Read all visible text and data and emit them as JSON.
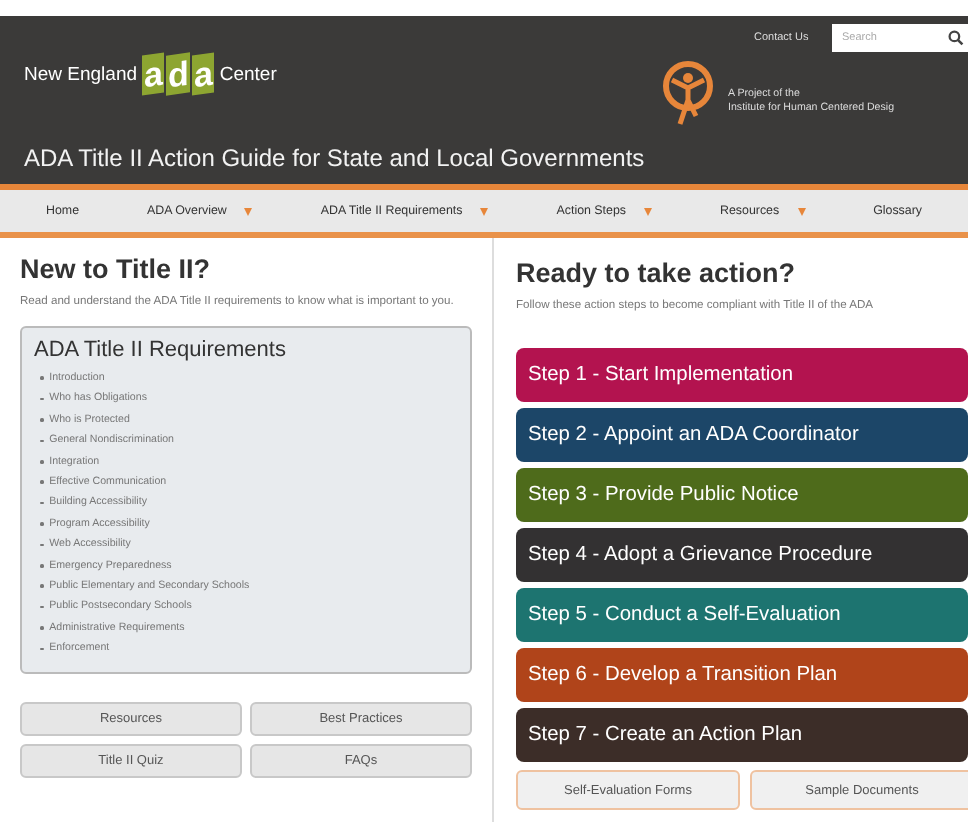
{
  "header": {
    "brand_before": "New England",
    "brand_mark": "ada",
    "brand_after": "Center",
    "contact_link": "Contact Us",
    "search": {
      "placeholder": "Search"
    },
    "project_line_1": "A Project of the",
    "project_line_2": "Institute for Human Centered Desig",
    "title": "ADA Title II Action Guide for State and Local Governments"
  },
  "nav": [
    {
      "label": "Home",
      "has_dropdown": false
    },
    {
      "label": "ADA Overview",
      "has_dropdown": true
    },
    {
      "label": "ADA Title II Requirements",
      "has_dropdown": true
    },
    {
      "label": "Action Steps",
      "has_dropdown": true
    },
    {
      "label": "Resources",
      "has_dropdown": true
    },
    {
      "label": "Glossary",
      "has_dropdown": false
    }
  ],
  "left": {
    "heading": "New to Title II?",
    "intro": "Read and understand the ADA Title II requirements to know what is important to you.",
    "box_title": "ADA Title II Requirements",
    "requirements": [
      "Introduction",
      "Who has Obligations",
      "Who is Protected",
      "General Nondiscrimination",
      "Integration",
      "Effective Communication",
      "Building Accessibility",
      "Program Accessibility",
      "Web Accessibility",
      "Emergency Preparedness",
      "Public Elementary and Secondary Schools",
      "Public Postsecondary Schools",
      "Administrative Requirements",
      "Enforcement"
    ],
    "buttons": [
      "Resources",
      "Best Practices",
      "Title II Quiz",
      "FAQs"
    ]
  },
  "right": {
    "heading": "Ready to take action?",
    "intro": "Follow these action steps to become compliant with Title II of the ADA",
    "steps": [
      {
        "label": "Step 1 - Start Implementation",
        "color": "#b3134f"
      },
      {
        "label": "Step 2 - Appoint an ADA Coordinator",
        "color": "#1c4668"
      },
      {
        "label": "Step 3 - Provide Public Notice",
        "color": "#4e6b1b"
      },
      {
        "label": "Step 4 - Adopt a Grievance Procedure",
        "color": "#333132"
      },
      {
        "label": "Step 5 - Conduct a Self-Evaluation",
        "color": "#1d7470"
      },
      {
        "label": "Step 6 - Develop a Transition Plan",
        "color": "#b0441a"
      },
      {
        "label": "Step 7 - Create an Action Plan",
        "color": "#3c2d28"
      }
    ],
    "buttons": [
      "Self-Evaluation Forms",
      "Sample Documents"
    ]
  }
}
